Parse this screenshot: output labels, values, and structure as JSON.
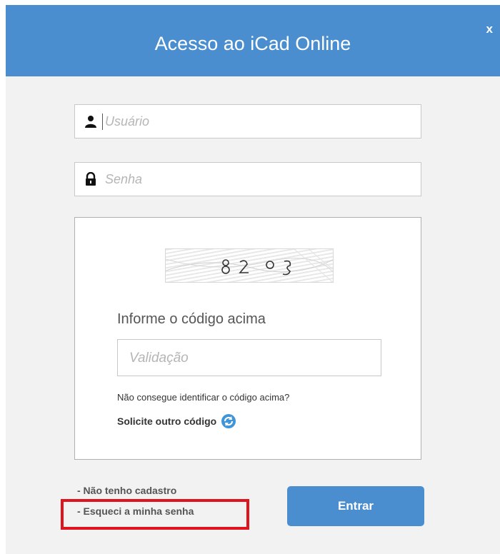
{
  "header": {
    "title": "Acesso ao iCad Online",
    "close_label": "x"
  },
  "login": {
    "username_placeholder": "Usuário",
    "password_placeholder": "Senha"
  },
  "captcha": {
    "prompt": "Informe o código acima",
    "validation_placeholder": "Validação",
    "hint": "Não consegue identificar o código acima?",
    "new_code_label": "Solicite outro código"
  },
  "links": {
    "no_account": "- Não tenho cadastro",
    "forgot_password": "- Esqueci a minha senha"
  },
  "submit_label": "Entrar",
  "colors": {
    "header": "#4a8ed0",
    "button": "#4a8ed0",
    "highlight": "#e0141e"
  },
  "icons": {
    "username": "user-icon",
    "password": "lock-icon",
    "refresh": "refresh-icon"
  }
}
